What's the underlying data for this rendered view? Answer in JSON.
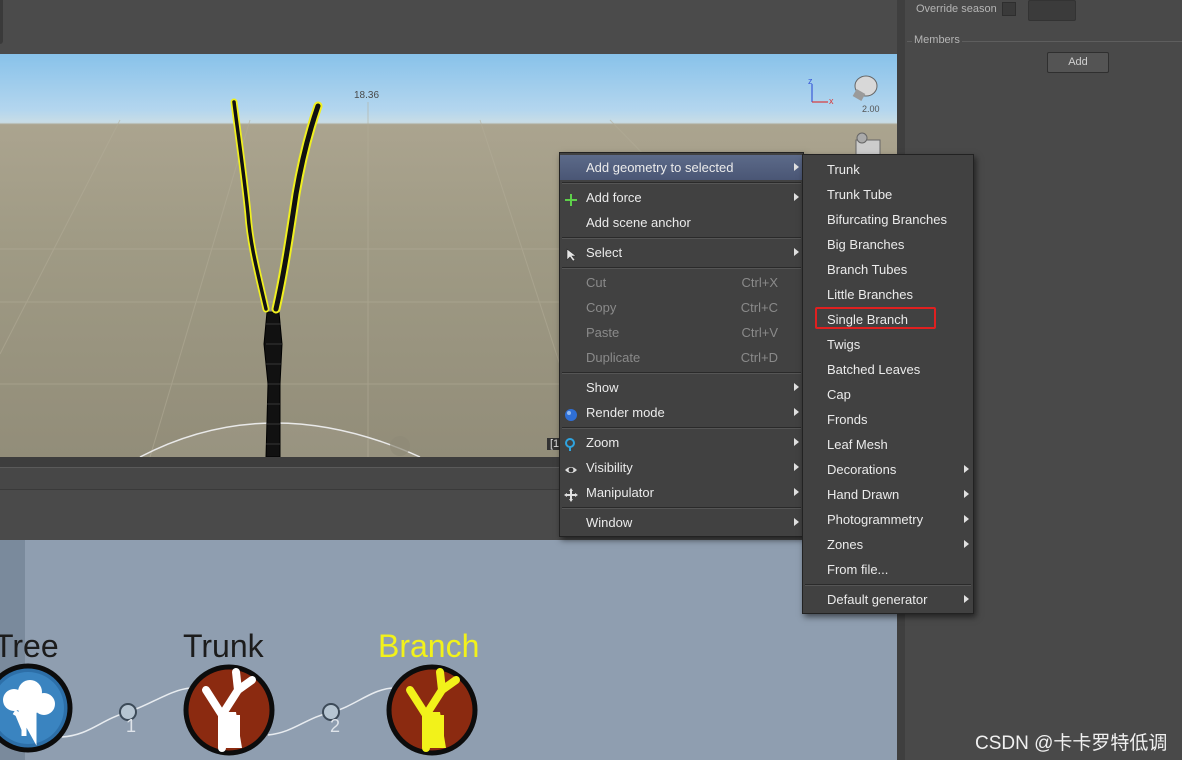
{
  "viewport": {
    "hud_value": "18.36",
    "zoom_value": "2.00",
    "axis_z": "z",
    "axis_x": "x",
    "frame_mark": "[1"
  },
  "right_panel": {
    "override_label": "Override season",
    "members_label": "Members",
    "add_label": "Add"
  },
  "context_menu": {
    "items": [
      {
        "label": "Add geometry to selected",
        "submenu": true,
        "highlighted": true
      },
      {
        "label": "Add force",
        "icon": "plus-icon",
        "submenu": true
      },
      {
        "label": "Add scene anchor"
      },
      {
        "label": "Select",
        "icon": "cursor-icon",
        "submenu": true
      },
      {
        "label": "Cut",
        "shortcut": "Ctrl+X",
        "disabled": true
      },
      {
        "label": "Copy",
        "shortcut": "Ctrl+C",
        "disabled": true
      },
      {
        "label": "Paste",
        "shortcut": "Ctrl+V",
        "disabled": true
      },
      {
        "label": "Duplicate",
        "shortcut": "Ctrl+D",
        "disabled": true
      },
      {
        "label": "Show",
        "submenu": true
      },
      {
        "label": "Render mode",
        "icon": "sphere-icon",
        "submenu": true
      },
      {
        "label": "Zoom",
        "icon": "magnifier-icon",
        "submenu": true
      },
      {
        "label": "Visibility",
        "icon": "eye-icon",
        "submenu": true
      },
      {
        "label": "Manipulator",
        "icon": "move-icon",
        "submenu": true
      },
      {
        "label": "Window",
        "submenu": true
      }
    ]
  },
  "geometry_submenu": {
    "items": [
      {
        "label": "Trunk"
      },
      {
        "label": "Trunk Tube"
      },
      {
        "label": "Bifurcating Branches"
      },
      {
        "label": "Big Branches"
      },
      {
        "label": "Branch Tubes"
      },
      {
        "label": "Little Branches"
      },
      {
        "label": "Single Branch",
        "marked": true
      },
      {
        "label": "Twigs"
      },
      {
        "label": "Batched Leaves"
      },
      {
        "label": "Cap"
      },
      {
        "label": "Fronds"
      },
      {
        "label": "Leaf Mesh"
      },
      {
        "label": "Decorations",
        "submenu": true
      },
      {
        "label": "Hand Drawn",
        "submenu": true
      },
      {
        "label": "Photogrammetry",
        "submenu": true
      },
      {
        "label": "Zones",
        "submenu": true
      },
      {
        "label": "From file..."
      },
      {
        "label": "Default generator",
        "submenu": true
      }
    ]
  },
  "node_graph": {
    "nodes": [
      {
        "label": "Tree",
        "selected": false
      },
      {
        "label": "Trunk",
        "selected": false
      },
      {
        "label": "Branch",
        "selected": true
      }
    ],
    "connections": [
      "1",
      "2"
    ]
  },
  "watermark": "CSDN @卡卡罗特低调",
  "colors": {
    "menu_bg": "#414141",
    "menu_highlight": "#56627f",
    "selected_node_text": "#f2f21a",
    "node_ring_fill": "#8b2a10",
    "marker_red": "#e02020"
  }
}
